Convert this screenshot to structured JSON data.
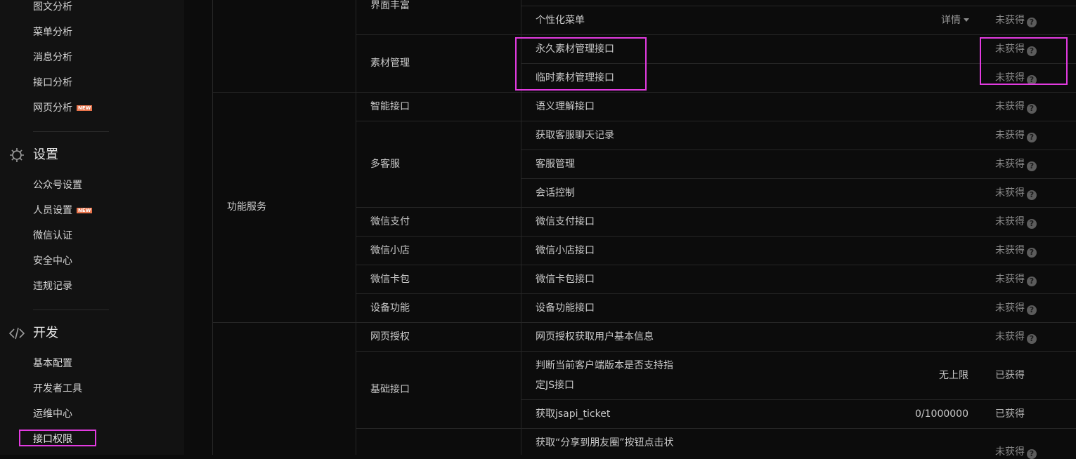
{
  "sidebar": {
    "stats_items": [
      {
        "label": "图文分析",
        "new": false
      },
      {
        "label": "菜单分析",
        "new": false
      },
      {
        "label": "消息分析",
        "new": false
      },
      {
        "label": "接口分析",
        "new": false
      },
      {
        "label": "网页分析",
        "new": true
      }
    ],
    "settings": {
      "title": "设置",
      "icon": "gear-icon",
      "items": [
        {
          "label": "公众号设置",
          "new": false
        },
        {
          "label": "人员设置",
          "new": true
        },
        {
          "label": "微信认证",
          "new": false
        },
        {
          "label": "安全中心",
          "new": false
        },
        {
          "label": "违规记录",
          "new": false
        }
      ]
    },
    "develop": {
      "title": "开发",
      "icon": "code-icon",
      "items": [
        {
          "label": "基本配置"
        },
        {
          "label": "开发者工具"
        },
        {
          "label": "运维中心"
        },
        {
          "label": "接口权限",
          "active": true
        }
      ]
    },
    "new_badge": "NEW"
  },
  "table": {
    "groups": {
      "function_service": "功能服务"
    },
    "rows": [
      {
        "category": "界面丰富",
        "api": "个性化菜单",
        "detail": "详情",
        "status": "未获得"
      },
      {
        "category": "素材管理",
        "api": "永久素材管理接口",
        "status": "未获得"
      },
      {
        "category": "",
        "api": "临时素材管理接口",
        "status": "未获得"
      },
      {
        "category": "智能接口",
        "api": "语义理解接口",
        "status": "未获得"
      },
      {
        "category": "多客服",
        "api": "获取客服聊天记录",
        "status": "未获得"
      },
      {
        "category": "",
        "api": "客服管理",
        "status": "未获得"
      },
      {
        "category": "",
        "api": "会话控制",
        "status": "未获得"
      },
      {
        "category": "微信支付",
        "api": "微信支付接口",
        "status": "未获得"
      },
      {
        "category": "微信小店",
        "api": "微信小店接口",
        "status": "未获得"
      },
      {
        "category": "微信卡包",
        "api": "微信卡包接口",
        "status": "未获得"
      },
      {
        "category": "设备功能",
        "api": "设备功能接口",
        "status": "未获得"
      },
      {
        "category": "网页授权",
        "api": "网页授权获取用户基本信息",
        "status": "未获得"
      },
      {
        "category": "基础接口",
        "api_line1": "判断当前客户端版本是否支持指",
        "api_line2": "定JS接口",
        "limit": "无上限",
        "status": "已获得"
      },
      {
        "category": "",
        "api": "获取jsapi_ticket",
        "limit": "0/1000000",
        "status": "已获得"
      },
      {
        "category": "",
        "api": "获取“分享到朋友圈”按钮点击状",
        "status": "未获得"
      }
    ]
  },
  "colors": {
    "highlight": "#e23be0",
    "background": "#0c0c0c",
    "sidebar": "#121212"
  }
}
